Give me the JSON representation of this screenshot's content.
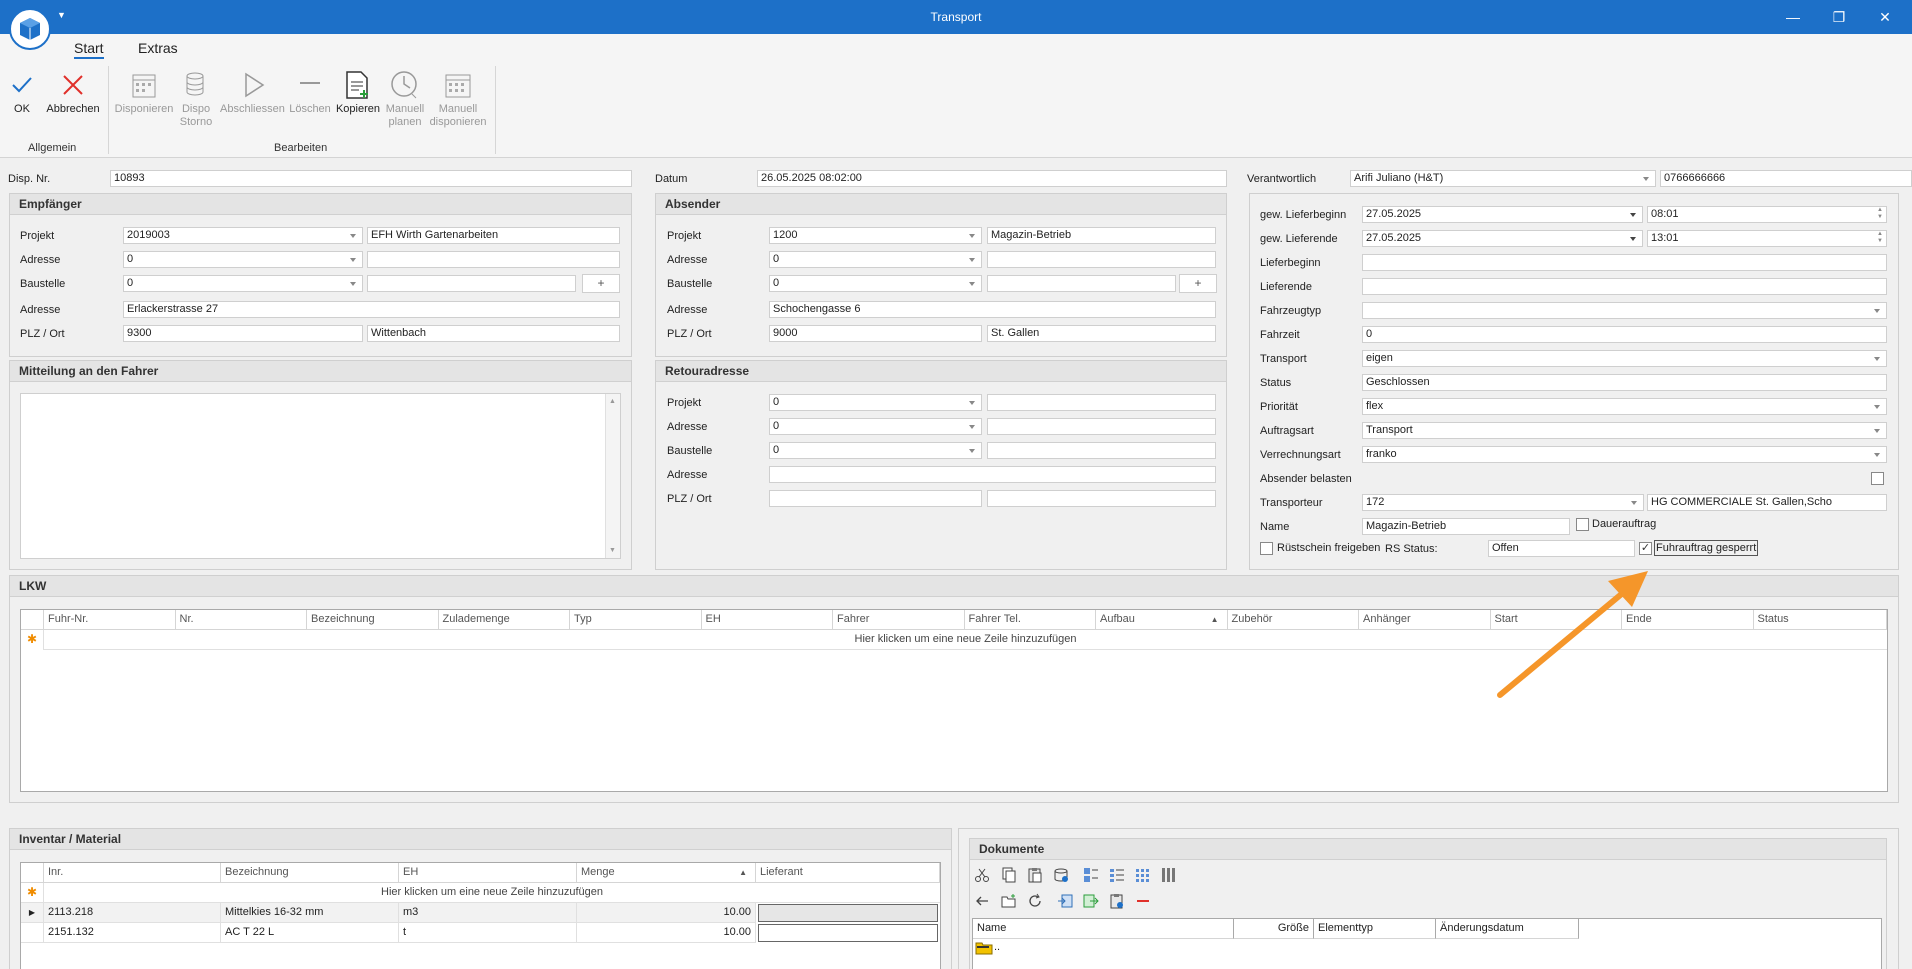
{
  "window": {
    "title": "Transport",
    "minimize": "—",
    "restore": "❐",
    "close": "✕"
  },
  "ribbon": {
    "tabs": [
      {
        "label": "Start"
      },
      {
        "label": "Extras"
      }
    ],
    "buttons": {
      "ok": "OK",
      "cancel": "Abbrechen",
      "disponieren": "Disponieren",
      "dispo_storno_1": "Dispo",
      "dispo_storno_2": "Storno",
      "abschliessen": "Abschliessen",
      "loeschen": "Löschen",
      "kopieren": "Kopieren",
      "manuell_planen_1": "Manuell",
      "manuell_planen_2": "planen",
      "manuell_dispo_1": "Manuell",
      "manuell_dispo_2": "disponieren"
    },
    "groups": {
      "allgemein": "Allgemein",
      "bearbeiten": "Bearbeiten"
    }
  },
  "header": {
    "disp_nr_label": "Disp. Nr.",
    "disp_nr": "10893",
    "datum_label": "Datum",
    "datum": "26.05.2025 08:02:00",
    "verantwortlich_label": "Verantwortlich",
    "verantwortlich": "Arifi Juliano (H&T)",
    "phone": "0766666666"
  },
  "empfaenger": {
    "title": "Empfänger",
    "projekt_label": "Projekt",
    "projekt": "2019003",
    "projekt_name": "EFH Wirth Gartenarbeiten",
    "adresse_label": "Adresse",
    "adresse_nr": "0",
    "baustelle_label": "Baustelle",
    "baustelle": "0",
    "plus": "+",
    "adresse2_label": "Adresse",
    "strasse": "Erlackerstrasse 27",
    "plz_label": "PLZ / Ort",
    "plz": "9300",
    "ort": "Wittenbach"
  },
  "absender": {
    "title": "Absender",
    "projekt_label": "Projekt",
    "projekt": "1200",
    "projekt_name": "Magazin-Betrieb",
    "adresse_label": "Adresse",
    "adresse_nr": "0",
    "baustelle_label": "Baustelle",
    "baustelle": "0",
    "plus": "+",
    "adresse2_label": "Adresse",
    "strasse": "Schochengasse 6",
    "plz_label": "PLZ / Ort",
    "plz": "9000",
    "ort": "St. Gallen"
  },
  "mitteilung": {
    "title": "Mitteilung an den Fahrer"
  },
  "retour": {
    "title": "Retouradresse",
    "projekt_label": "Projekt",
    "projekt": "0",
    "adresse_label": "Adresse",
    "adresse_nr": "0",
    "baustelle_label": "Baustelle",
    "baustelle": "0",
    "adresse2_label": "Adresse",
    "plz_label": "PLZ / Ort"
  },
  "details": {
    "lieferbeginn_gew_label": "gew. Lieferbeginn",
    "lieferbeginn_gew_date": "27.05.2025",
    "lieferbeginn_gew_time": "08:01",
    "lieferende_gew_label": "gew. Lieferende",
    "lieferende_gew_date": "27.05.2025",
    "lieferende_gew_time": "13:01",
    "lieferbeginn_label": "Lieferbeginn",
    "lieferende_label": "Lieferende",
    "fahrzeugtyp_label": "Fahrzeugtyp",
    "fahrzeit_label": "Fahrzeit",
    "fahrzeit": "0",
    "transport_label": "Transport",
    "transport": "eigen",
    "status_label": "Status",
    "status": "Geschlossen",
    "prioritaet_label": "Priorität",
    "prioritaet": "flex",
    "auftragsart_label": "Auftragsart",
    "auftragsart": "Transport",
    "verrechnungsart_label": "Verrechnungsart",
    "verrechnungsart": "franko",
    "absender_belasten_label": "Absender belasten",
    "transporteur_label": "Transporteur",
    "transporteur": "172",
    "transporteur_name": "HG COMMERCIALE St. Gallen,Scho",
    "name_label": "Name",
    "name": "Magazin-Betrieb",
    "dauerauftrag_label": "Dauerauftrag",
    "ruestschein_label": "Rüstschein freigeben",
    "rs_status_label": "RS Status:",
    "rs_status": "Offen",
    "fuhrauftrag_label": "Fuhrauftrag gesperrt",
    "fuhrauftrag_checked": "✓"
  },
  "lkw": {
    "title": "LKW",
    "columns": [
      "Fuhr-Nr.",
      "Nr.",
      "Bezeichnung",
      "Zulademenge",
      "Typ",
      "EH",
      "Fahrer",
      "Fahrer Tel.",
      "Aufbau",
      "Zubehör",
      "Anhänger",
      "Start",
      "Ende",
      "Status"
    ],
    "new_row": "Hier klicken um eine neue Zeile hinzuzufügen"
  },
  "inventar": {
    "title": "Inventar / Material",
    "columns": [
      "Inr.",
      "Bezeichnung",
      "EH",
      "Menge",
      "Lieferant"
    ],
    "new_row": "Hier klicken um eine neue Zeile hinzuzufügen",
    "rows": [
      {
        "inr": "2113.218",
        "bez": "Mittelkies 16-32 mm",
        "eh": "m3",
        "menge": "10.00",
        "lieferant": ""
      },
      {
        "inr": "2151.132",
        "bez": "AC T 22 L",
        "eh": "t",
        "menge": "10.00",
        "lieferant": ""
      }
    ]
  },
  "dokumente": {
    "title": "Dokumente",
    "columns": [
      "Name",
      "Größe",
      "Elementtyp",
      "Änderungsdatum"
    ],
    "rows": [
      {
        "name": ".."
      }
    ]
  },
  "annotation": {
    "color": "#f5962a"
  }
}
